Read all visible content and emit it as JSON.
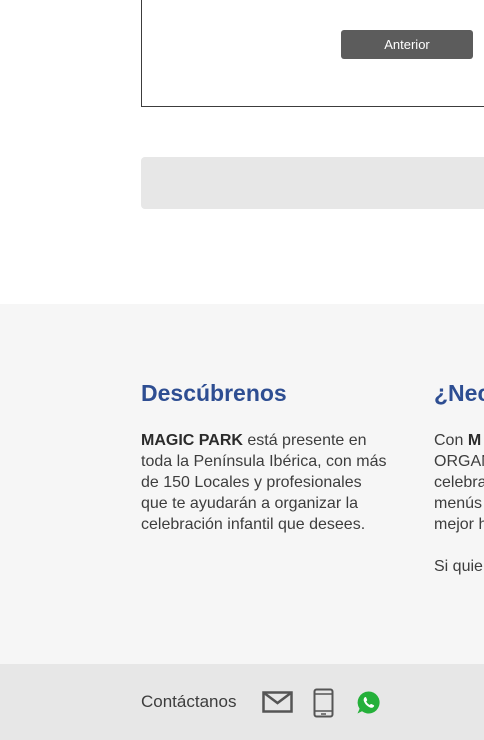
{
  "form": {
    "prev_button_label": "Anterior"
  },
  "discover": {
    "title": "Descúbrenos",
    "brand": "MAGIC PARK",
    "text": " está presente en toda la Península Ibérica, con más de 150 Locales y profesionales que te ayudarán a organizar la celebración infantil que desees."
  },
  "need": {
    "title": "¿Nec",
    "lines": [
      "Con",
      "M",
      "ORGAN",
      "celebra",
      "menús",
      "mejor h"
    ],
    "second": "Si quie"
  },
  "footer": {
    "contact_label": "Contáctanos",
    "icons": [
      "mail-icon",
      "phone-icon",
      "whatsapp-icon"
    ],
    "colors": {
      "icon": "#555555",
      "whatsapp": "#25b03a"
    }
  },
  "colors": {
    "heading": "#2e4e92",
    "button": "#5c5c5c",
    "section_bg": "#f6f6f6",
    "footer_bg": "#e7e7e7"
  }
}
